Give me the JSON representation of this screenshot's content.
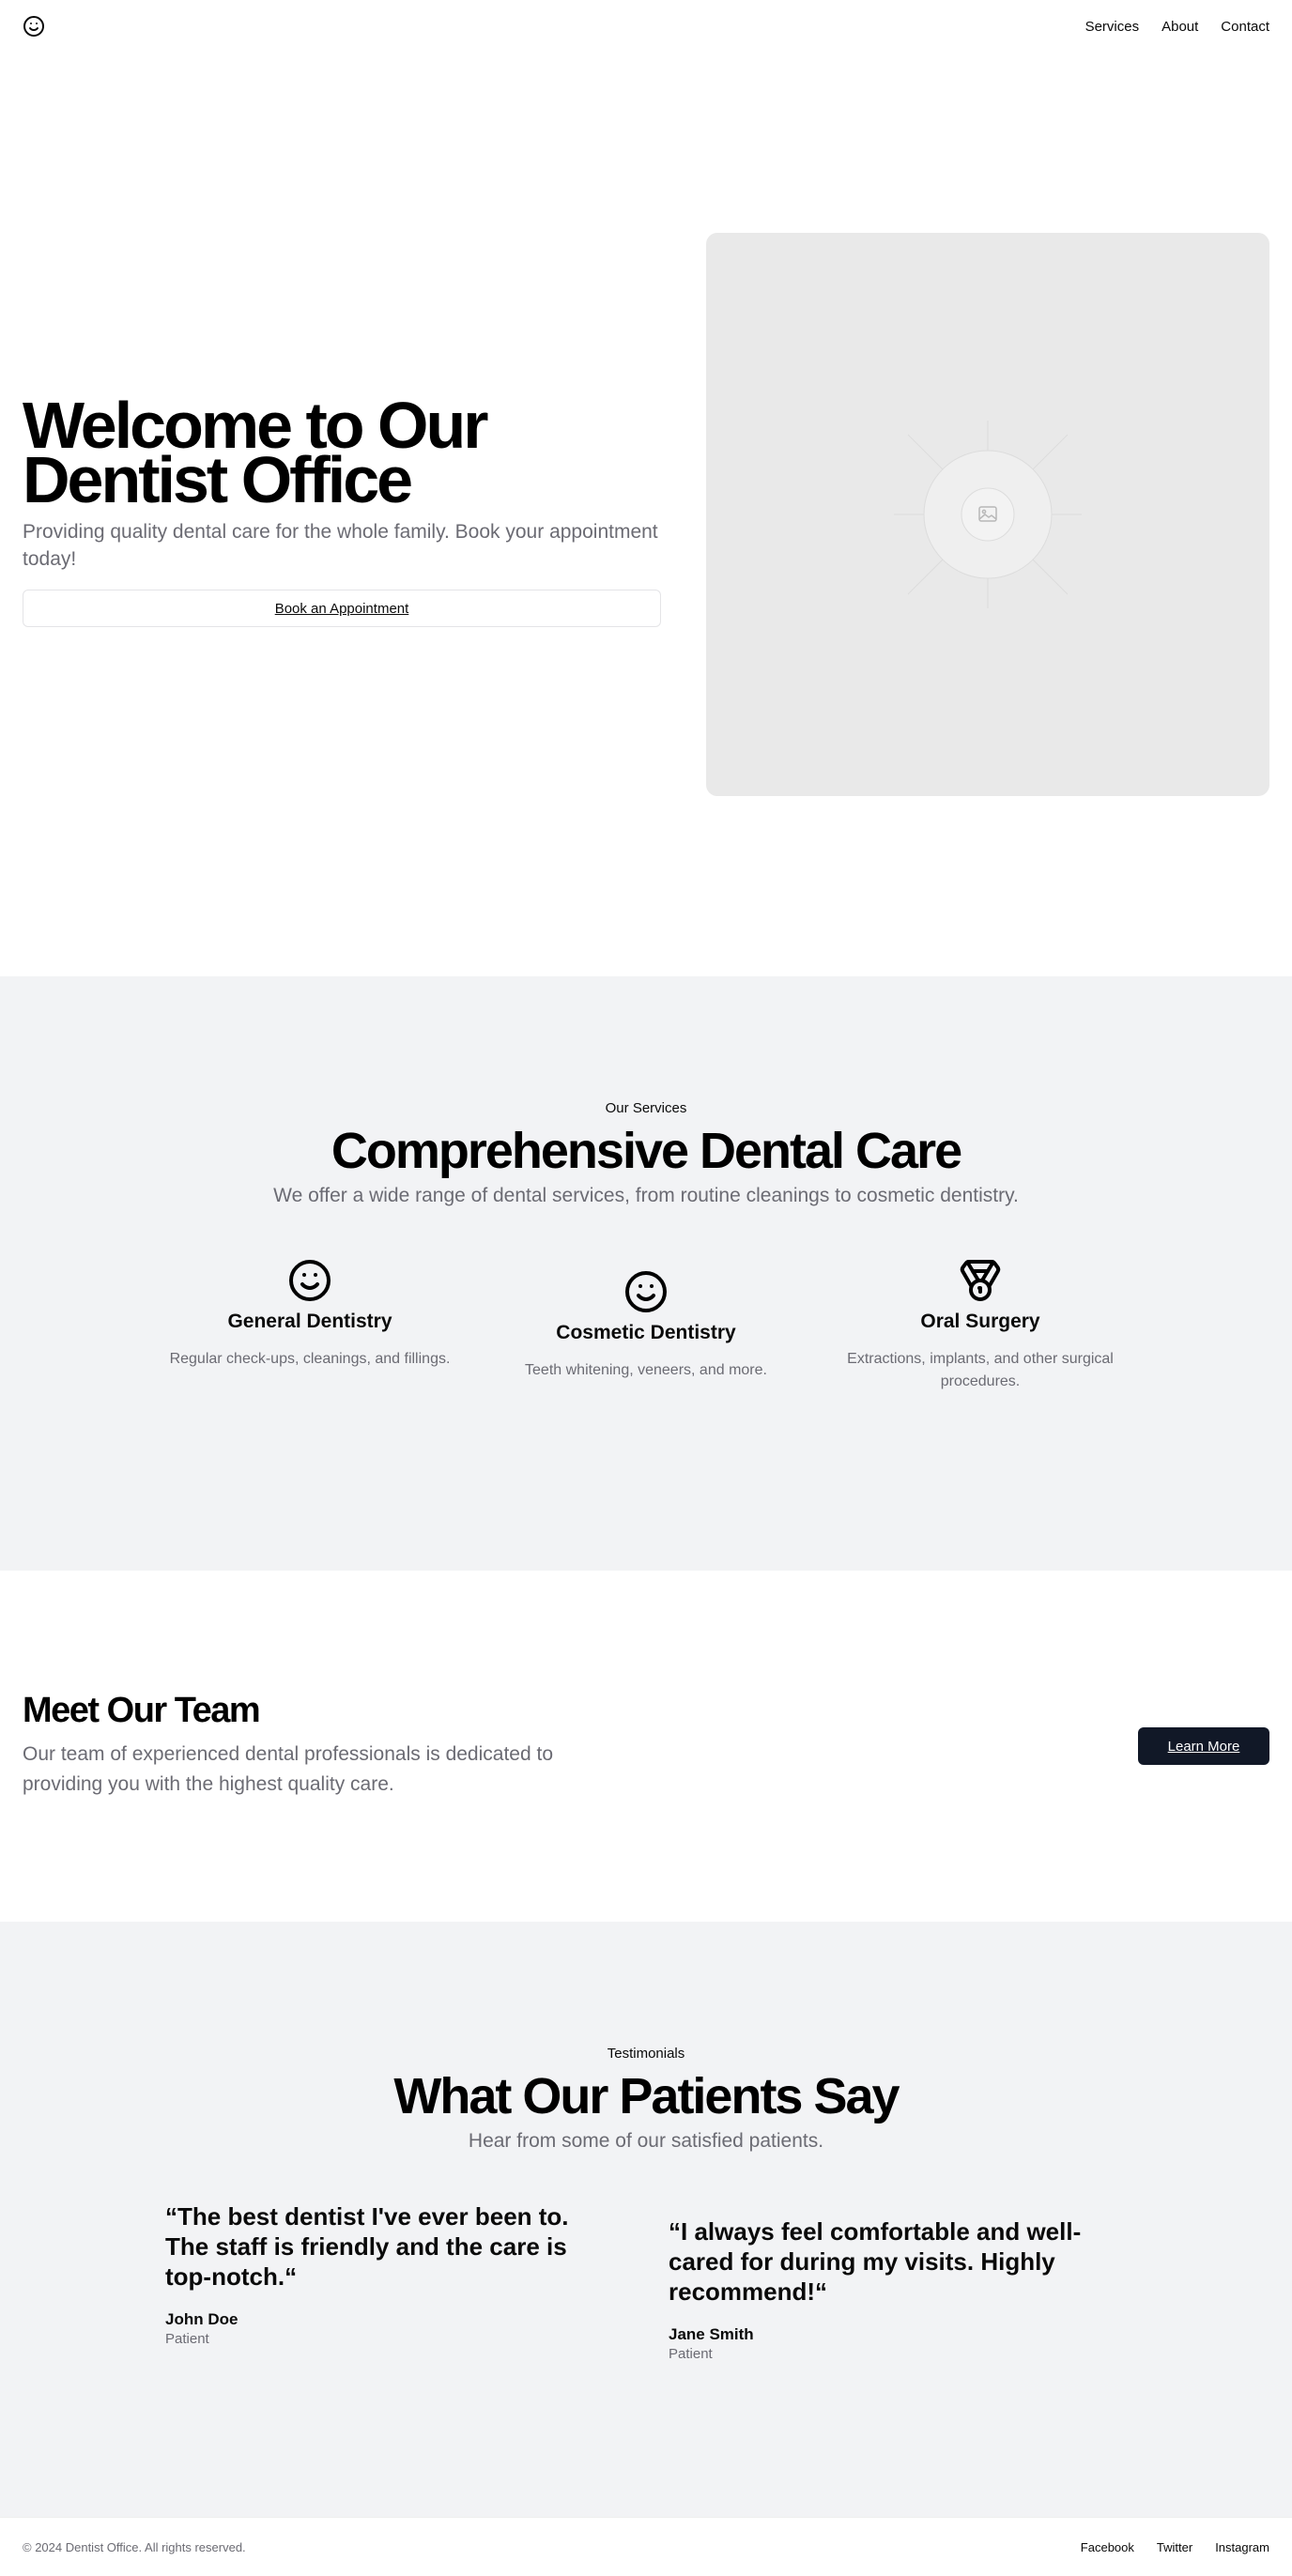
{
  "header": {
    "logo_icon": "smile-icon",
    "nav": [
      "Services",
      "About",
      "Contact"
    ]
  },
  "hero": {
    "title": "Welcome to Our Dentist Office",
    "subtitle": "Providing quality dental care for the whole family. Book your appointment today!",
    "button": "Book an Appointment",
    "image_icon": "image-placeholder-icon"
  },
  "services": {
    "eyebrow": "Our Services",
    "title": "Comprehensive Dental Care",
    "subtitle": "We offer a wide range of dental services, from routine cleanings to cosmetic dentistry.",
    "items": [
      {
        "icon": "smile-icon",
        "title": "General Dentistry",
        "desc": "Regular check-ups, cleanings, and fillings."
      },
      {
        "icon": "smile-icon",
        "title": "Cosmetic Dentistry",
        "desc": "Teeth whitening, veneers, and more."
      },
      {
        "icon": "medal-icon",
        "title": "Oral Surgery",
        "desc": "Extractions, implants, and other surgical procedures."
      }
    ]
  },
  "team": {
    "title": "Meet Our Team",
    "subtitle": "Our team of experienced dental professionals is dedicated to providing you with the highest quality care.",
    "button": "Learn More"
  },
  "testimonials": {
    "eyebrow": "Testimonials",
    "title": "What Our Patients Say",
    "subtitle": "Hear from some of our satisfied patients.",
    "items": [
      {
        "quote": "“The best dentist I've ever been to. The staff is friendly and the care is top-notch.“",
        "name": "John Doe",
        "role": "Patient"
      },
      {
        "quote": "“I always feel comfortable and well-cared for during my visits. Highly recommend!“",
        "name": "Jane Smith",
        "role": "Patient"
      }
    ]
  },
  "footer": {
    "copyright": "© 2024 Dentist Office. All rights reserved.",
    "links": [
      "Facebook",
      "Twitter",
      "Instagram"
    ]
  },
  "colors": {
    "section_bg": "#f2f3f5",
    "muted_text": "#6b6b73",
    "dark_button": "#111827",
    "placeholder_bg": "#e9e9e9"
  }
}
